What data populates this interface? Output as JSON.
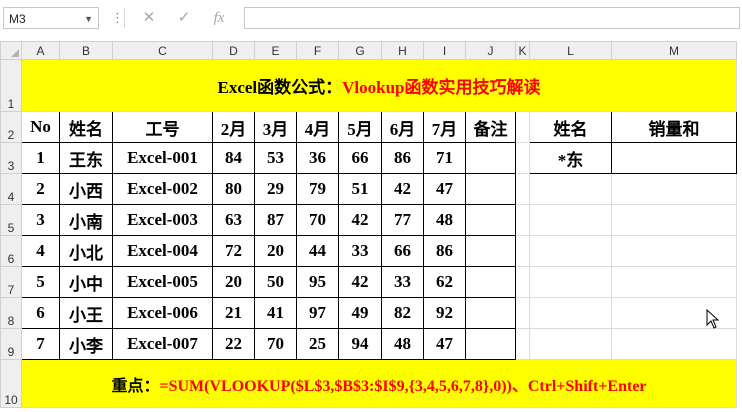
{
  "formula_bar": {
    "name_box": "M3",
    "cancel_icon": "✕",
    "enter_icon": "✓",
    "function_icon": "fx",
    "formula": ""
  },
  "columns": [
    "A",
    "B",
    "C",
    "D",
    "E",
    "F",
    "G",
    "H",
    "I",
    "J",
    "K",
    "L",
    "M"
  ],
  "rows": [
    "1",
    "2",
    "3",
    "4",
    "5",
    "6",
    "7",
    "8",
    "9",
    "10"
  ],
  "title": {
    "part1": "Excel函数公式：",
    "part2": "Vlookup函数实用技巧解读"
  },
  "headers": [
    "No",
    "姓名",
    "工号",
    "2月",
    "3月",
    "4月",
    "5月",
    "6月",
    "7月",
    "备注"
  ],
  "lookup_headers": [
    "姓名",
    "销量和"
  ],
  "lookup_value": "*东",
  "data": [
    {
      "no": "1",
      "name": "王东",
      "id": "Excel-001",
      "m2": "84",
      "m3": "53",
      "m4": "36",
      "m5": "66",
      "m6": "86",
      "m7": "71",
      "note": ""
    },
    {
      "no": "2",
      "name": "小西",
      "id": "Excel-002",
      "m2": "80",
      "m3": "29",
      "m4": "79",
      "m5": "51",
      "m6": "42",
      "m7": "47",
      "note": ""
    },
    {
      "no": "3",
      "name": "小南",
      "id": "Excel-003",
      "m2": "63",
      "m3": "87",
      "m4": "70",
      "m5": "42",
      "m6": "77",
      "m7": "48",
      "note": ""
    },
    {
      "no": "4",
      "name": "小北",
      "id": "Excel-004",
      "m2": "72",
      "m3": "20",
      "m4": "44",
      "m5": "33",
      "m6": "66",
      "m7": "86",
      "note": ""
    },
    {
      "no": "5",
      "name": "小中",
      "id": "Excel-005",
      "m2": "20",
      "m3": "50",
      "m4": "95",
      "m5": "42",
      "m6": "33",
      "m7": "62",
      "note": ""
    },
    {
      "no": "6",
      "name": "小王",
      "id": "Excel-006",
      "m2": "21",
      "m3": "41",
      "m4": "97",
      "m5": "49",
      "m6": "82",
      "m7": "92",
      "note": ""
    },
    {
      "no": "7",
      "name": "小李",
      "id": "Excel-007",
      "m2": "22",
      "m3": "70",
      "m4": "25",
      "m5": "94",
      "m6": "48",
      "m7": "47",
      "note": ""
    }
  ],
  "footer": {
    "label": "重点：",
    "formula": "=SUM(VLOOKUP($L$3,$B$3:$I$9,{3,4,5,6,7,8},0))、Ctrl+Shift+Enter"
  },
  "colors": {
    "yellow": "#ffff00",
    "red": "#ff0000",
    "header_bg": "#efefef"
  }
}
